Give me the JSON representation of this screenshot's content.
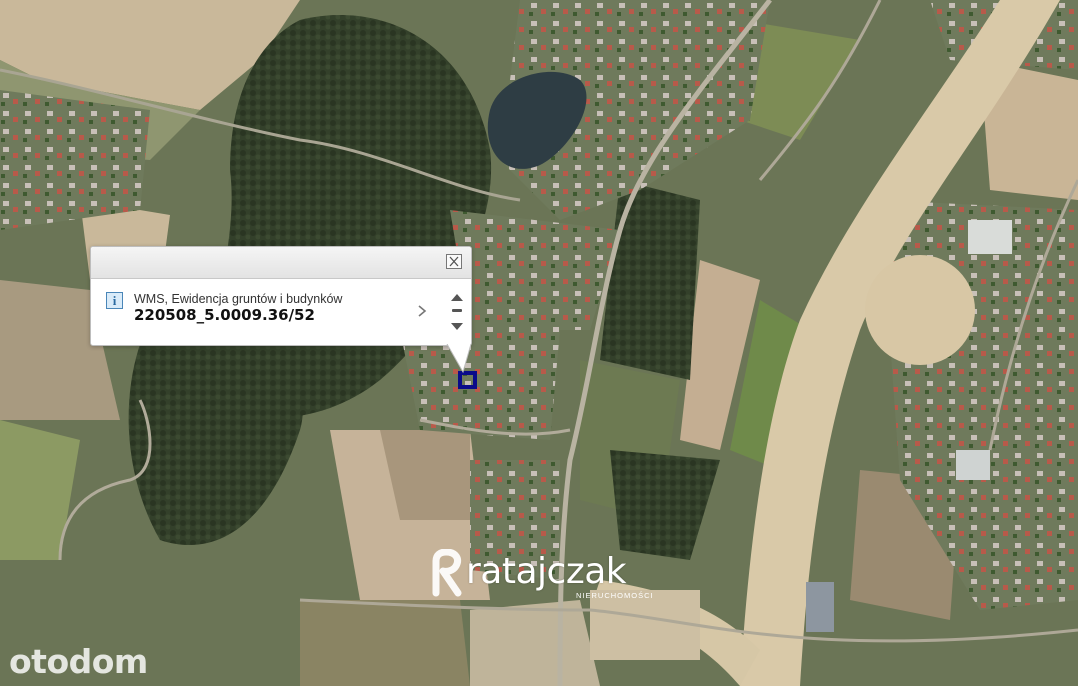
{
  "popup": {
    "layer_name": "WMS, Ewidencja gruntów i budynków",
    "parcel_id": "220508_5.0009.36/52",
    "info_icon_glyph": "i",
    "icons": [
      "close-icon",
      "info-icon",
      "chevron-right-icon",
      "arrow-up-icon",
      "minus-icon",
      "arrow-down-icon"
    ]
  },
  "watermarks": {
    "brand_name": "ratajczak",
    "brand_sub": "NIERUCHOMOŚCI",
    "site_name": "otodom"
  },
  "colors": {
    "parcel_outline": "#0a0a8a",
    "field_light": "#c9b89a",
    "forest": "#2f3a25",
    "construction": "#d9c9a8"
  }
}
